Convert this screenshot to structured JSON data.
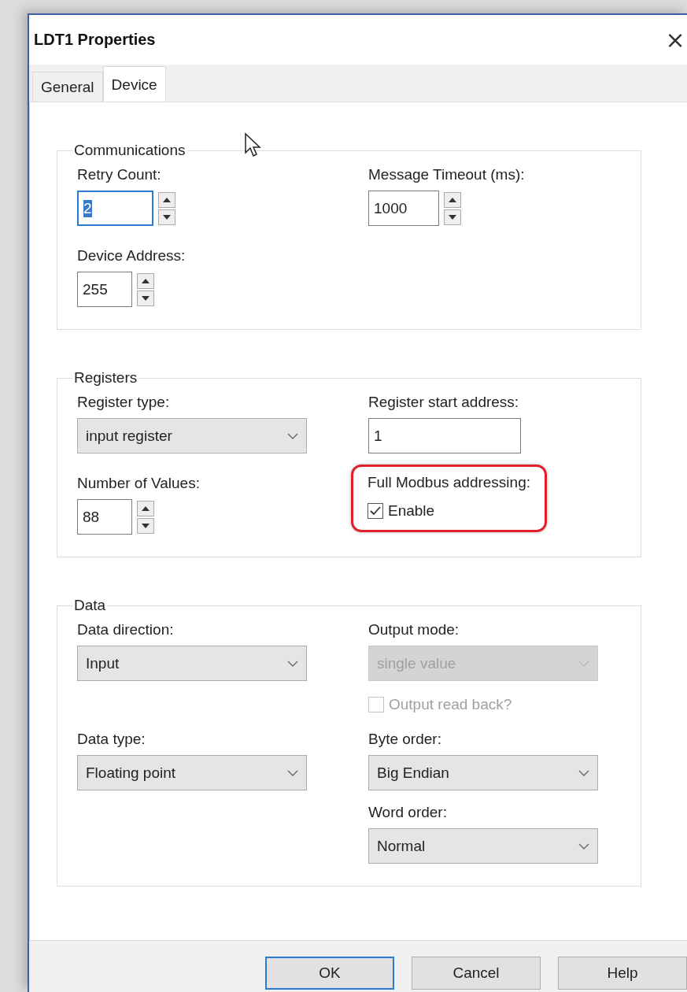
{
  "window": {
    "title": "LDT1 Properties",
    "close": "×"
  },
  "tabs": [
    {
      "label": "General",
      "selected": false
    },
    {
      "label": "Device",
      "selected": true
    }
  ],
  "groups": [
    {
      "title": "Communications",
      "rows": [
        {
          "left": {
            "kind": "spinner",
            "label": "Retry Count:",
            "value": "2",
            "focused": true
          },
          "right": {
            "kind": "spinner",
            "label": "Message Timeout (ms):",
            "value": "1000",
            "focused": false
          }
        },
        {
          "left": {
            "kind": "spinner",
            "label": "Device Address:",
            "value": "255",
            "focused": false
          }
        }
      ]
    },
    {
      "title": "Registers",
      "rows": [
        {
          "left": {
            "kind": "dropdown",
            "label": "Register type:",
            "value": "input register",
            "disabled": false
          },
          "right": {
            "kind": "text",
            "label": "Register start address:",
            "value": "1"
          }
        },
        {
          "left": {
            "kind": "spinner",
            "label": "Number of Values:",
            "value": "88",
            "focused": false
          },
          "right": {
            "kind": "checkbox",
            "label": "Full Modbus addressing:",
            "checkbox_label": "Enable",
            "checked": true,
            "disabled": false,
            "highlighted": true
          }
        }
      ]
    },
    {
      "title": "Data",
      "rows": [
        {
          "left": {
            "kind": "dropdown",
            "label": "Data direction:",
            "value": "Input",
            "disabled": false
          },
          "right": {
            "kind": "dropdown",
            "label": "Output mode:",
            "value": "single value",
            "disabled": true
          }
        },
        {
          "right": {
            "kind": "checkbox",
            "checkbox_label": "Output read back?",
            "checked": false,
            "disabled": true
          }
        },
        {
          "left": {
            "kind": "dropdown",
            "label": "Data type:",
            "value": "Floating point",
            "disabled": false
          },
          "right": {
            "kind": "dropdown",
            "label": "Byte order:",
            "value": "Big Endian",
            "disabled": false
          }
        },
        {
          "right": {
            "kind": "dropdown",
            "label": "Word order:",
            "value": "Normal",
            "disabled": false
          }
        }
      ]
    }
  ],
  "buttons": [
    {
      "label": "OK",
      "default": true
    },
    {
      "label": "Cancel",
      "default": false
    },
    {
      "label": "Help",
      "default": false
    }
  ]
}
